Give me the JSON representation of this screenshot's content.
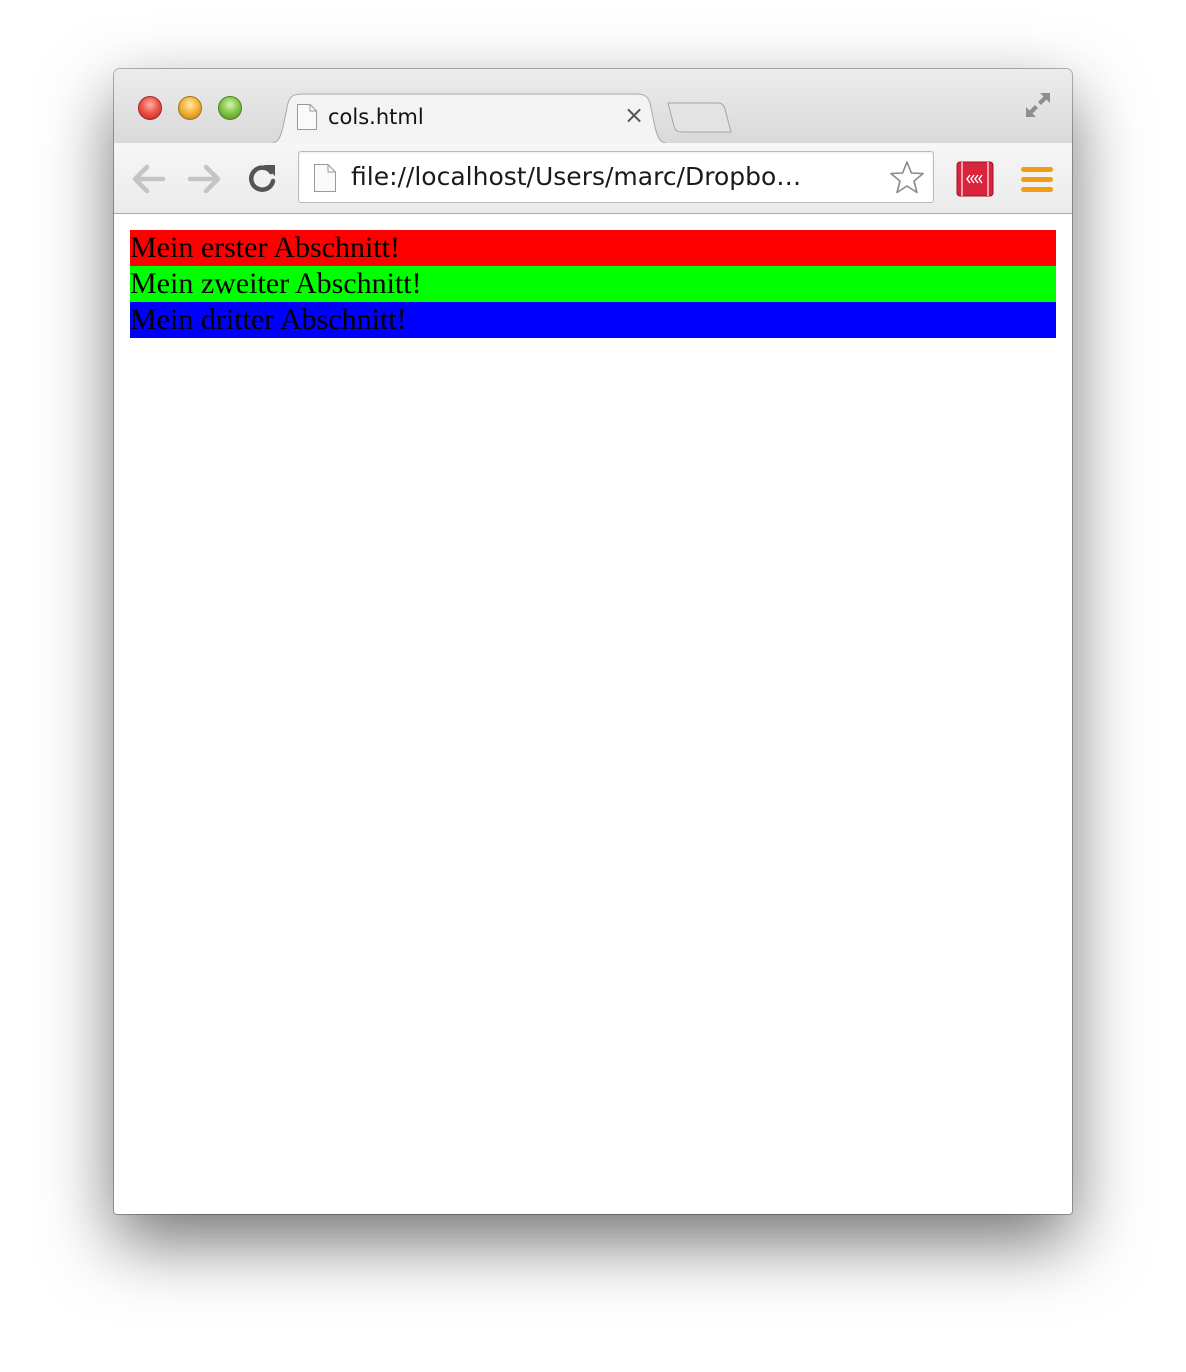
{
  "tab": {
    "title": "cols.html",
    "close_symbol": "×"
  },
  "omnibox": {
    "url": "file://localhost/Users/marc/Dropbo…"
  },
  "icons": {
    "close": "window-close-icon",
    "minimize": "window-minimize-icon",
    "zoom": "window-zoom-icon",
    "back": "arrow-left-icon",
    "forward": "arrow-right-icon",
    "reload": "reload-icon",
    "page": "page-icon",
    "star": "star-icon",
    "extension": "extension-icon",
    "menu": "hamburger-menu-icon",
    "fullscreen": "fullscreen-icon"
  },
  "sections": [
    {
      "text": "Mein erster Abschnitt!",
      "color": "#ff0000"
    },
    {
      "text": "Mein zweiter Abschnitt!",
      "color": "#00ff00"
    },
    {
      "text": "Mein dritter Abschnitt!",
      "color": "#0000ff"
    }
  ],
  "colors": {
    "menu_accent": "#f39c12",
    "extension_red": "#d8243c"
  }
}
